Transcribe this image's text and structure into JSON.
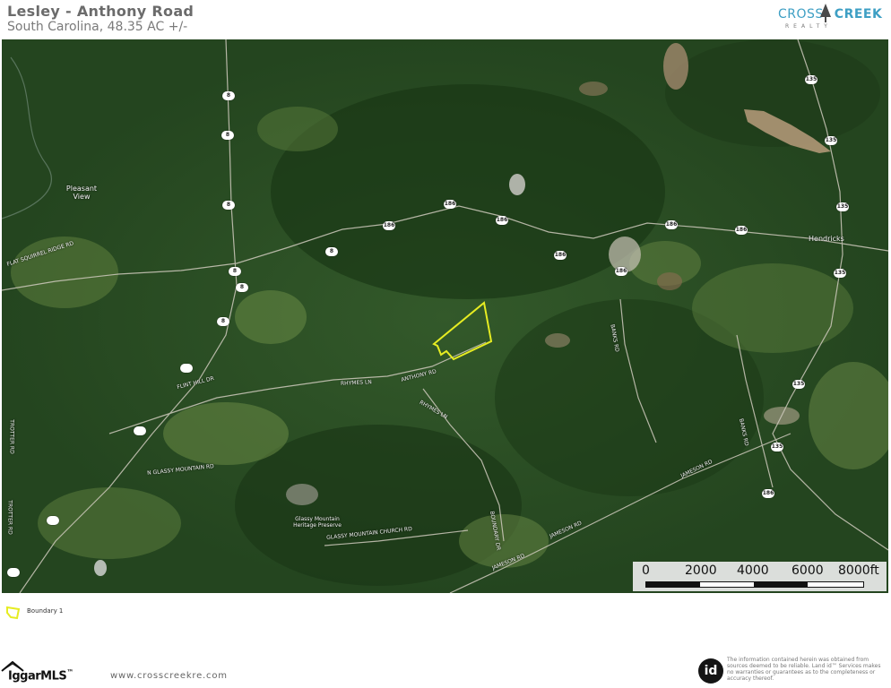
{
  "header": {
    "title": "Lesley - Anthony Road",
    "subtitle": "South Carolina, 48.35 AC +/-",
    "brand_primary": "CROSS",
    "brand_secondary": "CREEK",
    "brand_tagline": "REALTY"
  },
  "map": {
    "type": "satellite",
    "road_labels": [
      "FLAT SQUIRREL RIDGE RD",
      "FLINT HILL DR",
      "RHYMES LN",
      "ANTHONY RD",
      "RHYMES LN",
      "N GLASSY MOUNTAIN RD",
      "GLASSY MOUNTAIN CHURCH RD",
      "BOUNDARY DR",
      "JAMESON RD",
      "JAMESON RD",
      "JAMESON RD",
      "BANKS RD",
      "BANKS RD",
      "TROTTER RD",
      "TROTTER RD"
    ],
    "place_labels": [
      "Pleasant View",
      "Hendricks",
      "Glassy Mountain Heritage Preserve"
    ],
    "shields": [
      "135",
      "135",
      "135",
      "135",
      "135",
      "135",
      "186",
      "186",
      "186",
      "186",
      "186",
      "186",
      "186",
      "186",
      "8",
      "8",
      "8",
      "8",
      "8",
      "8",
      "8"
    ],
    "scale": {
      "labels": [
        "0",
        "2000",
        "4000",
        "6000",
        "8000ft"
      ]
    },
    "boundary_color": "#e6ec22"
  },
  "legend": {
    "label": "Boundary 1"
  },
  "footer": {
    "mls_logo": "IggarMLS",
    "mls_tm": "™",
    "url": "www.crosscreekre.com",
    "id_badge": "id",
    "disclaimer": "The information contained herein was obtained from sources deemed to be reliable. Land id™ Services makes no warranties or guarantees as to the completeness or accuracy thereof."
  }
}
